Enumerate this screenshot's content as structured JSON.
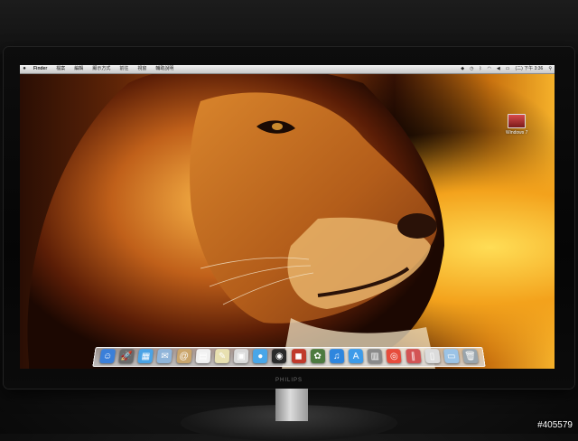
{
  "menubar": {
    "apple_icon": "apple-icon",
    "items": [
      "Finder",
      "檔案",
      "編輯",
      "顯示方式",
      "前往",
      "視窗",
      "輔助說明"
    ],
    "status_icons": [
      "dropbox-icon",
      "clock-icon",
      "bluetooth-icon",
      "wifi-icon",
      "volume-icon",
      "battery-icon"
    ],
    "clock": "(二) 下午 3:36",
    "search_icon": "spotlight-icon"
  },
  "desktop": {
    "icon_label": "Windows 7"
  },
  "dock": {
    "apps": [
      {
        "name": "finder-icon",
        "glyph": "☺",
        "color": "#3b7fd9"
      },
      {
        "name": "launchpad-icon",
        "glyph": "🚀",
        "color": "#6a6a6a"
      },
      {
        "name": "mission-control-icon",
        "glyph": "▦",
        "color": "#4aa3e6"
      },
      {
        "name": "mail-icon",
        "glyph": "✉",
        "color": "#8fb4d9"
      },
      {
        "name": "address-book-icon",
        "glyph": "@",
        "color": "#caa56b"
      },
      {
        "name": "calendar-icon",
        "glyph": "▤",
        "color": "#f0f0f0"
      },
      {
        "name": "notes-icon",
        "glyph": "✎",
        "color": "#e8e0b0"
      },
      {
        "name": "preview-icon",
        "glyph": "▣",
        "color": "#dadada"
      },
      {
        "name": "messages-icon",
        "glyph": "●",
        "color": "#49a6e8"
      },
      {
        "name": "facetime-icon",
        "glyph": "◉",
        "color": "#2a2a2a"
      },
      {
        "name": "photobooth-icon",
        "glyph": "◼",
        "color": "#c0392b"
      },
      {
        "name": "iphoto-icon",
        "glyph": "✿",
        "color": "#4c7a3f"
      },
      {
        "name": "itunes-icon",
        "glyph": "♫",
        "color": "#2e86de"
      },
      {
        "name": "app-store-icon",
        "glyph": "A",
        "color": "#3d9be9"
      },
      {
        "name": "boot-camp-icon",
        "glyph": "▥",
        "color": "#8a8a8a"
      },
      {
        "name": "chrome-icon",
        "glyph": "◎",
        "color": "#e74c3c"
      },
      {
        "name": "parallels-icon",
        "glyph": "∥",
        "color": "#d35454"
      },
      {
        "name": "documents-stack-icon",
        "glyph": "▯",
        "color": "#dcdcdc"
      },
      {
        "name": "downloads-folder-icon",
        "glyph": "▭",
        "color": "#9bc3e6"
      },
      {
        "name": "trash-icon",
        "glyph": "🗑",
        "color": "#9aa5ad"
      }
    ]
  },
  "watermark": "#405579",
  "monitor_brand": "PHILIPS"
}
